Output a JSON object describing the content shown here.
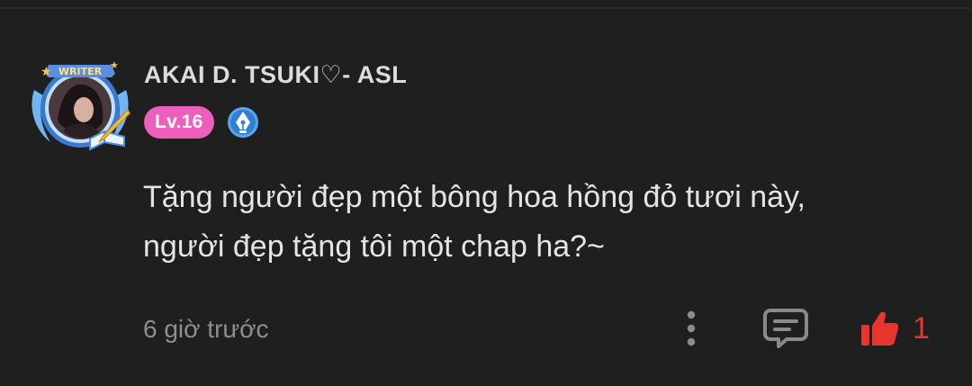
{
  "comment": {
    "avatar": {
      "badge_text": "WRITER",
      "frame_color": "#4f8fe0",
      "accent_color": "#f3c645"
    },
    "author": {
      "name": "AKAI D. TSUKI♡- ASL",
      "level_label": "Lv.16",
      "level_color": "#ec5fbd",
      "writer_icon": "pen-nib-icon"
    },
    "body": {
      "line1": "Tặng người đẹp một bông hoa hồng đỏ tươi này,",
      "line2": "người đẹp tặng tôi một chap ha?~"
    },
    "footer": {
      "timestamp": "6 giờ trước",
      "more_icon": "more-vertical-icon",
      "reply_icon": "comment-bubble-icon",
      "like_icon": "thumbs-up-icon",
      "like_count": "1",
      "like_color": "#e8352f"
    }
  }
}
